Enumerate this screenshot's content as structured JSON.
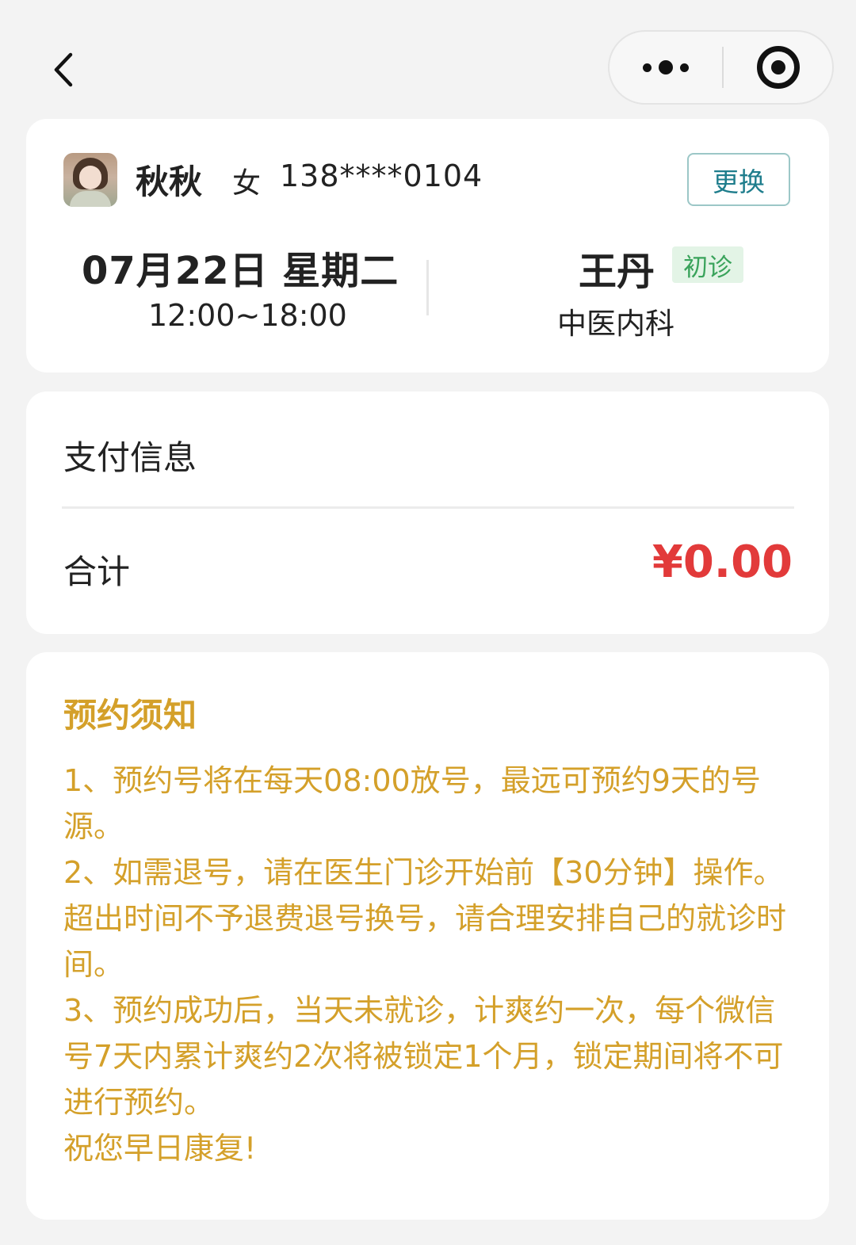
{
  "patient": {
    "name": "秋秋",
    "gender": "女",
    "phone": "138****0104",
    "change_label": "更换"
  },
  "appointment": {
    "date": "07月22日 星期二",
    "time": "12:00~18:00",
    "doctor": "王丹",
    "visit_type": "初诊",
    "department": "中医内科"
  },
  "payment": {
    "title": "支付信息",
    "total_label": "合计",
    "total_amount": "¥0.00"
  },
  "notice": {
    "title": "预约须知",
    "items": [
      "1、预约号将在每天08:00放号，最远可预约9天的号源。",
      "2、如需退号，请在医生门诊开始前【30分钟】操作。超出时间不予退费退号换号，请合理安排自己的就诊时间。",
      "3、预约成功后，当天未就诊，计爽约一次，每个微信号7天内累计爽约2次将被锁定1个月，锁定期间将不可进行预约。",
      "祝您早日康复!"
    ]
  },
  "colors": {
    "accent_teal": "#1e7d8c",
    "amount_red": "#e23a3a",
    "notice_gold": "#d4a02a",
    "tag_green": "#3aa35b"
  },
  "icons": {
    "back": "chevron-left-icon",
    "more": "more-dots-icon",
    "close": "target-close-icon"
  }
}
